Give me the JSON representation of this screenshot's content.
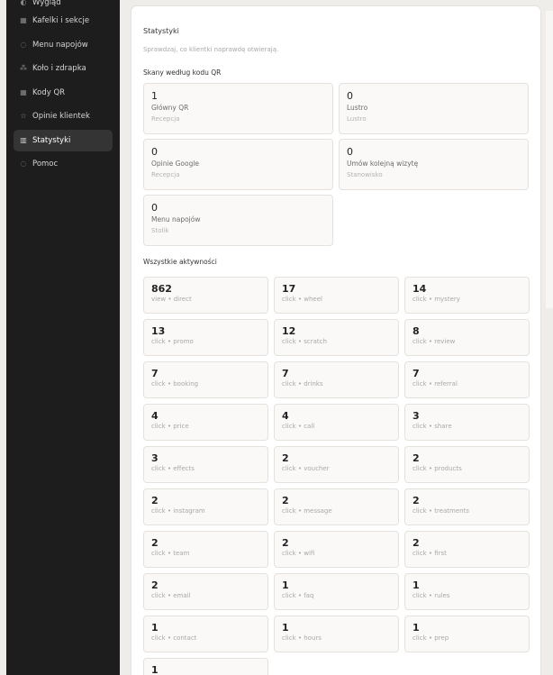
{
  "sidebar": {
    "items": [
      {
        "label": "Wygląd",
        "icon": "palette-icon",
        "glyph": "◐"
      },
      {
        "label": "Kafelki i sekcje",
        "icon": "grid-icon",
        "glyph": "▦"
      },
      {
        "label": "Menu napojów",
        "icon": "cup-icon",
        "glyph": "◌"
      },
      {
        "label": "Koło i zdrapka",
        "icon": "spark-icon",
        "glyph": "⁂"
      },
      {
        "label": "Kody QR",
        "icon": "qr-icon",
        "glyph": "▦"
      },
      {
        "label": "Opinie klientek",
        "icon": "star-icon",
        "glyph": "☆"
      },
      {
        "label": "Statystyki",
        "icon": "bar-chart-icon",
        "glyph": "▥",
        "active": true
      },
      {
        "label": "Pomoc",
        "icon": "help-icon",
        "glyph": "◌"
      }
    ]
  },
  "header": {
    "title": "Statystyki",
    "subtitle": "Sprawdzaj, co klientki naprawdę otwierają."
  },
  "qr_section": {
    "title": "Skany według kodu QR",
    "cards": [
      {
        "count": "1",
        "name": "Główny QR",
        "location": "Recepcja"
      },
      {
        "count": "0",
        "name": "Lustro",
        "location": "Lustro"
      },
      {
        "count": "0",
        "name": "Opinie Google",
        "location": "Recepcja"
      },
      {
        "count": "0",
        "name": "Umów kolejną wizytę",
        "location": "Stanowisko"
      },
      {
        "count": "0",
        "name": "Menu napojów",
        "location": "Stolik"
      }
    ]
  },
  "activity_section": {
    "title": "Wszystkie aktywności",
    "cards": [
      {
        "count": "862",
        "label": "view • direct"
      },
      {
        "count": "17",
        "label": "click • wheel"
      },
      {
        "count": "14",
        "label": "click • mystery"
      },
      {
        "count": "13",
        "label": "click • promo"
      },
      {
        "count": "12",
        "label": "click • scratch"
      },
      {
        "count": "8",
        "label": "click • review"
      },
      {
        "count": "7",
        "label": "click • booking"
      },
      {
        "count": "7",
        "label": "click • drinks"
      },
      {
        "count": "7",
        "label": "click • referral"
      },
      {
        "count": "4",
        "label": "click • price"
      },
      {
        "count": "4",
        "label": "click • call"
      },
      {
        "count": "3",
        "label": "click • share"
      },
      {
        "count": "3",
        "label": "click • effects"
      },
      {
        "count": "2",
        "label": "click • voucher"
      },
      {
        "count": "2",
        "label": "click • products"
      },
      {
        "count": "2",
        "label": "click • instagram"
      },
      {
        "count": "2",
        "label": "click • message"
      },
      {
        "count": "2",
        "label": "click • treatments"
      },
      {
        "count": "2",
        "label": "click • team"
      },
      {
        "count": "2",
        "label": "click • wifi"
      },
      {
        "count": "2",
        "label": "click • first"
      },
      {
        "count": "2",
        "label": "click • email"
      },
      {
        "count": "1",
        "label": "click • faq"
      },
      {
        "count": "1",
        "label": "click • rules"
      },
      {
        "count": "1",
        "label": "click • contact"
      },
      {
        "count": "1",
        "label": "click • hours"
      },
      {
        "count": "1",
        "label": "click • prep"
      },
      {
        "count": "1",
        "label": ""
      }
    ]
  }
}
